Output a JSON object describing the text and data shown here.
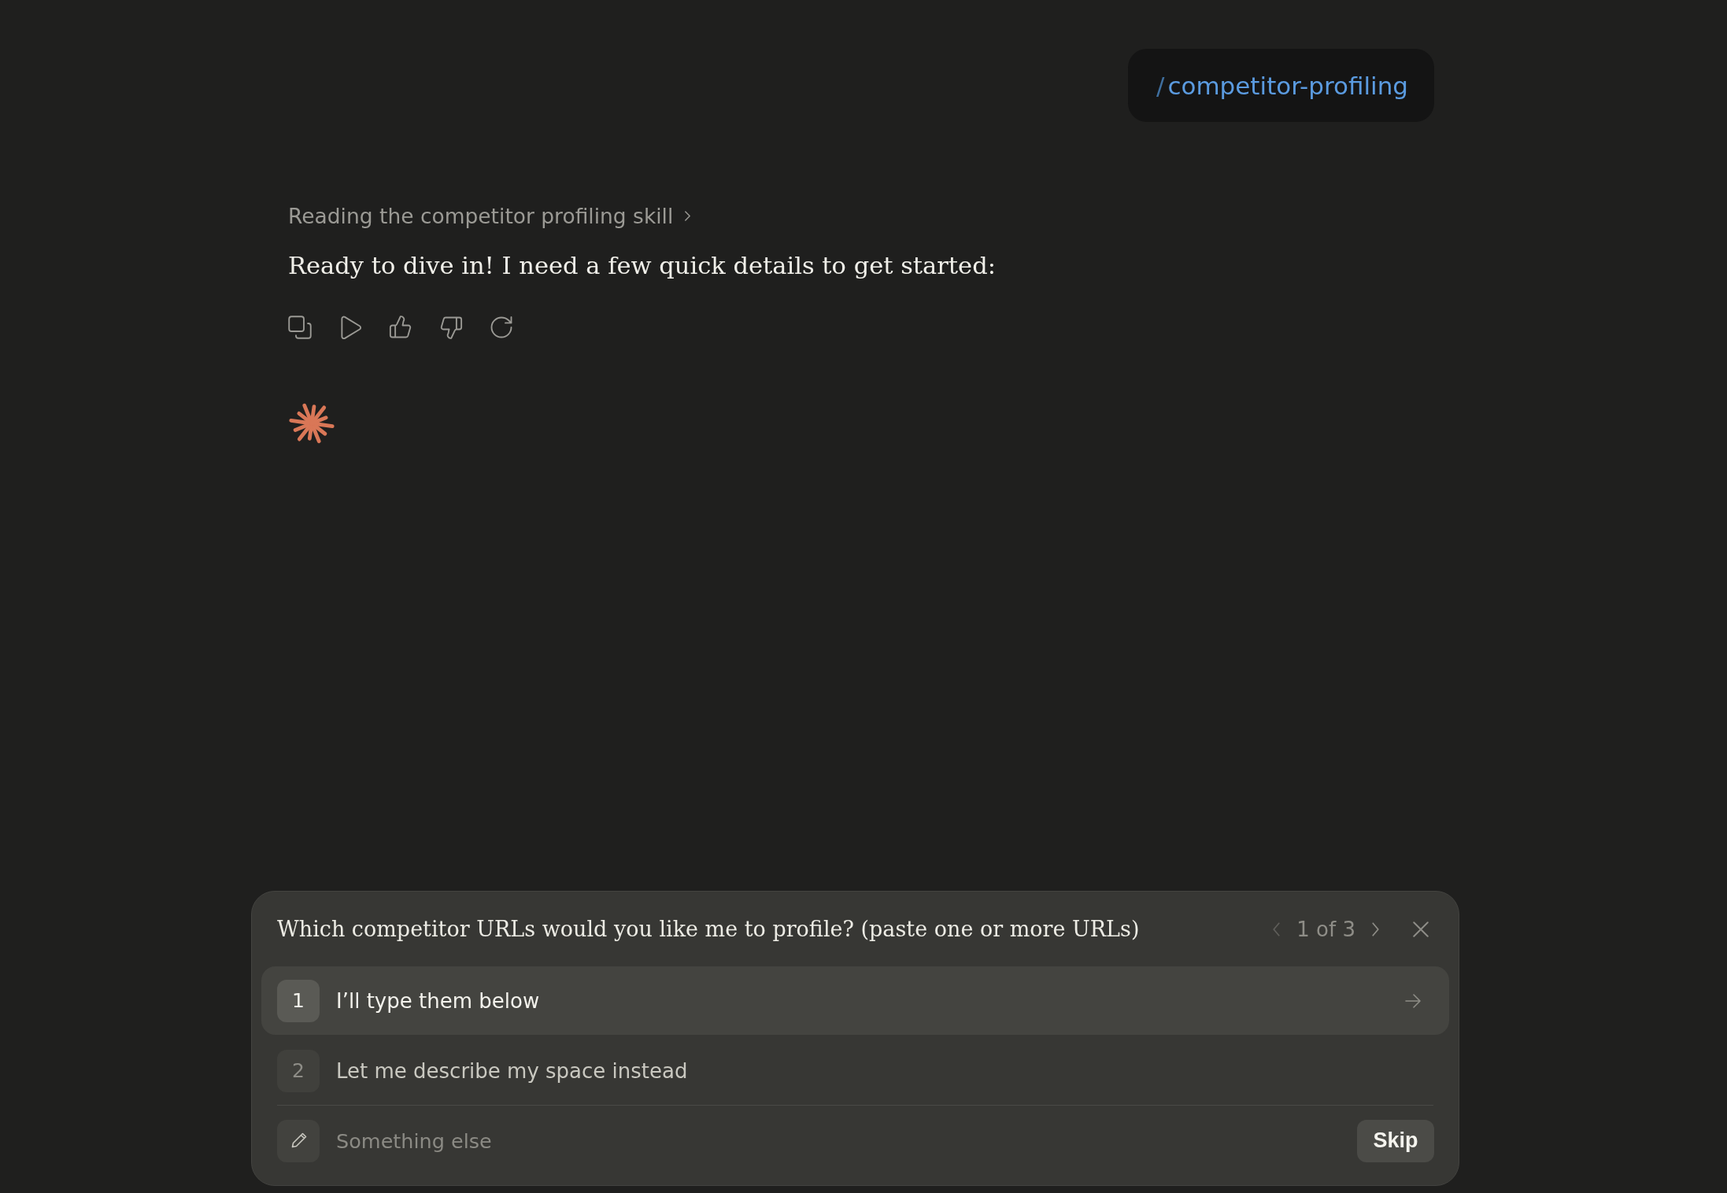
{
  "command": {
    "prefix": "/",
    "name": "competitor-profiling"
  },
  "status": {
    "text": "Reading the competitor profiling skill",
    "expanded": false
  },
  "message": {
    "text": "Ready to dive in! I need a few quick details to get started:"
  },
  "question": {
    "text": "Which competitor URLs would you like me to profile? (paste one or more URLs)",
    "pager": {
      "text": "1 of 3",
      "prev_disabled": true,
      "next_disabled": false
    }
  },
  "options": [
    {
      "number": "1",
      "label": "I’ll type them below",
      "selected": true
    },
    {
      "number": "2",
      "label": "Let me describe my space instead",
      "selected": false
    }
  ],
  "other": {
    "placeholder": "Something else"
  },
  "skip": {
    "label": "Skip"
  }
}
